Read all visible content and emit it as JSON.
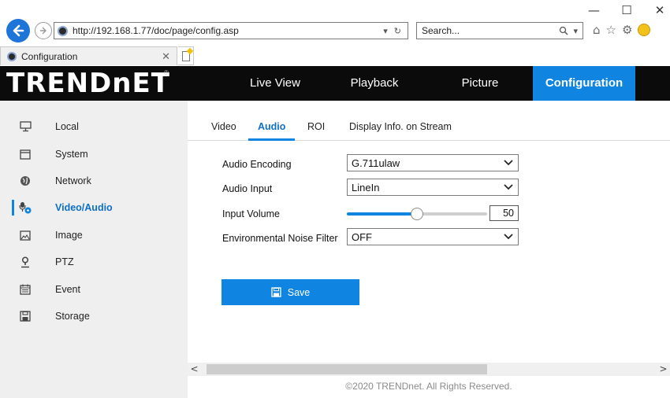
{
  "browser": {
    "url": "http://192.168.1.77/doc/page/config.asp",
    "search_placeholder": "Search...",
    "tab_title": "Configuration",
    "window_controls": {
      "minimize": "—",
      "maximize": "☐",
      "close": "✕"
    }
  },
  "header": {
    "logo_text": "TRENDnET",
    "logo_reg": "®",
    "nav": [
      {
        "label": "Live View"
      },
      {
        "label": "Playback"
      },
      {
        "label": "Picture"
      },
      {
        "label": "Configuration",
        "active": true
      }
    ]
  },
  "sidebar": {
    "items": [
      {
        "label": "Local",
        "icon": "monitor-icon"
      },
      {
        "label": "System",
        "icon": "window-icon"
      },
      {
        "label": "Network",
        "icon": "globe-icon"
      },
      {
        "label": "Video/Audio",
        "icon": "video-audio-icon",
        "active": true
      },
      {
        "label": "Image",
        "icon": "image-icon"
      },
      {
        "label": "PTZ",
        "icon": "ptz-icon"
      },
      {
        "label": "Event",
        "icon": "calendar-icon"
      },
      {
        "label": "Storage",
        "icon": "floppy-icon"
      }
    ]
  },
  "subtabs": [
    {
      "label": "Video"
    },
    {
      "label": "Audio",
      "active": true
    },
    {
      "label": "ROI"
    },
    {
      "label": "Display Info. on Stream"
    }
  ],
  "form": {
    "audio_encoding": {
      "label": "Audio Encoding",
      "value": "G.711ulaw"
    },
    "audio_input": {
      "label": "Audio Input",
      "value": "LineIn"
    },
    "input_volume": {
      "label": "Input Volume",
      "value": "50",
      "level": 50,
      "max": 100
    },
    "noise_filter": {
      "label": "Environmental Noise Filter",
      "value": "OFF"
    }
  },
  "save_label": "Save",
  "footer": "©2020 TRENDnet. All Rights Reserved.",
  "colors": {
    "accent": "#0f84e0",
    "header_bg": "#0b0b0b",
    "sidebar_bg": "#efefef"
  }
}
